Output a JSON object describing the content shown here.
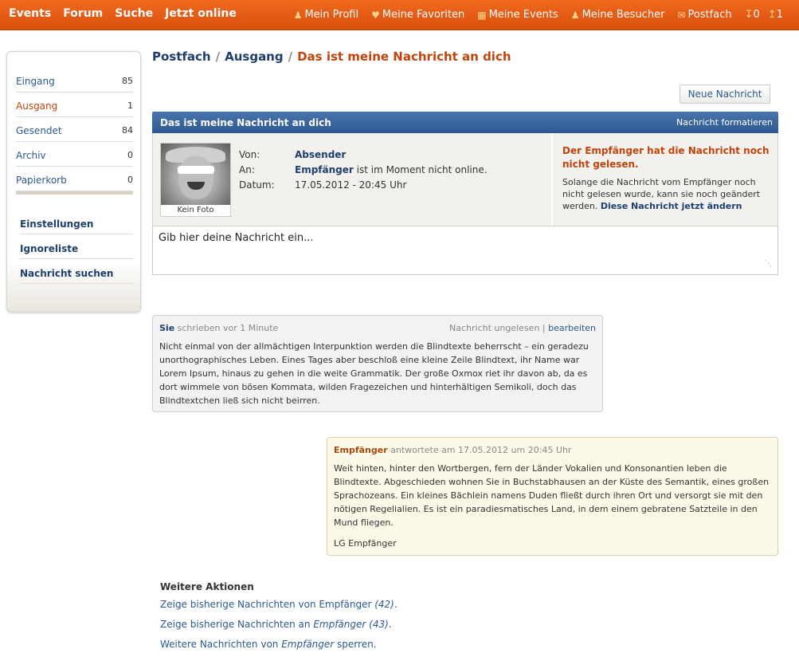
{
  "topnav": {
    "left": [
      "Events",
      "Forum",
      "Suche",
      "Jetzt online"
    ],
    "right": [
      {
        "icon": "user-icon",
        "label": "Mein Profil"
      },
      {
        "icon": "heart-icon",
        "label": "Meine Favoriten"
      },
      {
        "icon": "calendar-icon",
        "label": "Meine Events"
      },
      {
        "icon": "visitors-icon",
        "label": "Meine Besucher"
      },
      {
        "icon": "envelope-icon",
        "label": "Postfach"
      }
    ],
    "count_down": "0",
    "count_up": "1"
  },
  "sidebar": {
    "folders": [
      {
        "label": "Eingang",
        "count": "85"
      },
      {
        "label": "Ausgang",
        "count": "1"
      },
      {
        "label": "Gesendet",
        "count": "84"
      },
      {
        "label": "Archiv",
        "count": "0"
      },
      {
        "label": "Papierkorb",
        "count": "0"
      }
    ],
    "links": [
      "Einstellungen",
      "Ignoreliste",
      "Nachricht suchen"
    ]
  },
  "breadcrumb": {
    "items": [
      "Postfach",
      "Ausgang"
    ],
    "current": "Das ist meine Nachricht an dich"
  },
  "new_message_button": "Neue Nachricht",
  "panel": {
    "title": "Das ist meine Nachricht an dich",
    "format_link": "Nachricht formatieren",
    "avatar_caption": "Kein Foto",
    "from_label": "Von:",
    "from_value": "Absender",
    "to_label": "An:",
    "to_value": "Empfänger",
    "to_status": " ist im Moment nicht online.",
    "date_label": "Datum:",
    "date_value": "17.05.2012 - 20:45 Uhr",
    "warning": "Der Empfänger hat die Nachricht noch nicht gelesen.",
    "note": "Solange die Nachricht vom Empfänger noch nicht gelesen wurde, kann sie noch geändert werden.",
    "change_link": "Diese Nachricht jetzt ändern",
    "input_placeholder": "Gib hier deine Nachricht ein..."
  },
  "messages": {
    "sent": {
      "author": "Sie",
      "time": " schrieben vor 1 Minute",
      "status": "Nachricht ungelesen | ",
      "edit": "bearbeiten",
      "text": "Nicht einmal von der allmächtigen Interpunktion werden die Blindtexte beherrscht – ein geradezu unorthographisches Leben. Eines Tages aber beschloß eine kleine Zeile Blindtext, ihr Name war Lorem Ipsum, hinaus zu gehen in die weite Grammatik. Der große Oxmox riet ihr davon ab, da es dort wimmele von bösen Kommata, wilden Fragezeichen und hinterhältigen Semikoli, doch das Blindtextchen ließ sich nicht beirren."
    },
    "received": {
      "author": "Empfänger",
      "time": " antwortete am 17.05.2012 um 20:45 Uhr",
      "text": "Weit hinten, hinter den Wortbergen, fern der Länder Vokalien und Konsonantien leben die Blindtexte. Abgeschieden wohnen Sie in Buchstabhausen an der Küste des Semantik, eines großen Sprachozeans. Ein kleines Bächlein namens Duden fließt durch ihren Ort und versorgt sie mit den nötigen Regelialien. Es ist ein paradiesmatisches Land, in dem einem gebratene Satzteile in den Mund fliegen.",
      "signature": "LG Empfänger"
    }
  },
  "further_actions": {
    "title": "Weitere Aktionen",
    "items": [
      {
        "prefix": "Zeige bisherige Nachrichten von Empfänger ",
        "em": "(42)",
        "suffix": "."
      },
      {
        "prefix": "Zeige bisherige Nachrichten an ",
        "em": "Empfänger (43)",
        "suffix": "."
      },
      {
        "prefix": "Weitere Nachrichten von ",
        "em": "Empfänger",
        "suffix": " sperren."
      }
    ]
  }
}
